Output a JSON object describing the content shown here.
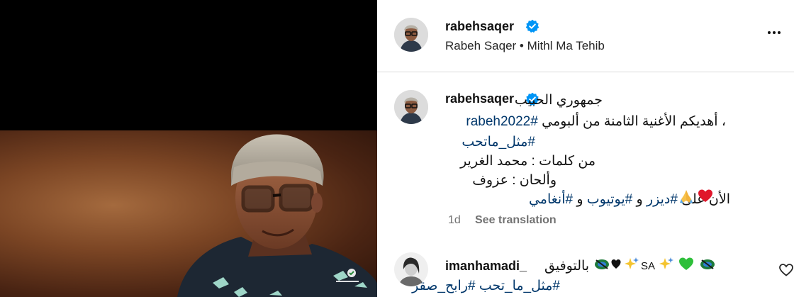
{
  "post": {
    "media": {
      "badge_icon": "rotana-logo-icon"
    },
    "header": {
      "username": "rabehsaqer",
      "verified_icon": "verified-badge-icon",
      "subtitle": "Rabeh Saqer • Mithl Ma Tehib",
      "more_icon": "more-options-icon"
    },
    "caption": {
      "username": "rabehsaqer",
      "line1": "جمهوري الحبيب",
      "line2_text": "، أهديكم الأغنية الثامنة من ألبومي ",
      "line2_tag": "#rabeh2022",
      "line3_tag": "#مثل_ماتحب",
      "line4": "من كلمات : محمد الغرير",
      "line5": "وألحان : عزوف",
      "line6_prefix": "الأن على ",
      "line6_tag1": "#ديزر",
      "line6_and1": " و ",
      "line6_tag2": "#يوتيوب",
      "line6_and2": " و ",
      "line6_tag3": "#أنغامي",
      "line6_emojis": [
        "heart-icon",
        "praying-hands-icon"
      ],
      "time": "1d",
      "see_translation": "See translation"
    },
    "comment": {
      "username": "imanhamadi_",
      "text": "بالتوفيق",
      "mid_text": "SA",
      "tags": "#مثل_ما_تحب #رابح_صقر",
      "emojis": [
        "flag-icon",
        "black-heart-icon",
        "sparkles-icon",
        "green-heart-icon"
      ],
      "like_icon": "heart-outline-icon"
    },
    "colors": {
      "link": "#00376b",
      "muted": "#737373",
      "verified": "#0095f6"
    }
  }
}
